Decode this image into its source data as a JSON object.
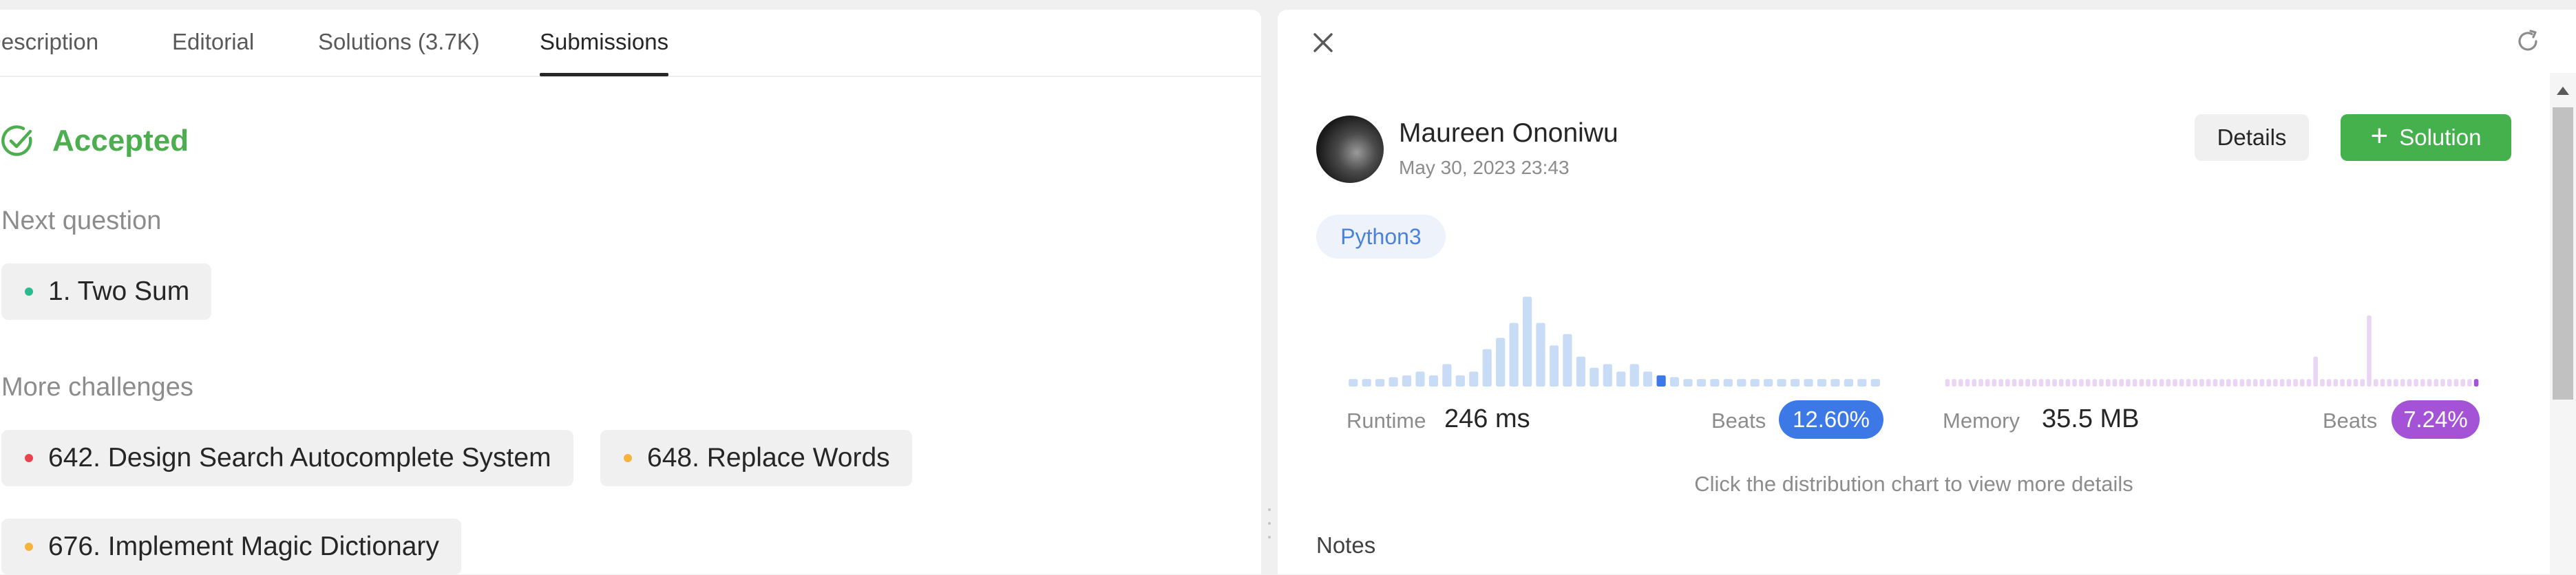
{
  "tabs": [
    {
      "label": "Description"
    },
    {
      "label": "Editorial"
    },
    {
      "label": "Solutions (3.7K)"
    },
    {
      "label": "Submissions"
    }
  ],
  "result": {
    "status": "Accepted",
    "status_color": "#4cae4f"
  },
  "next_question": {
    "heading": "Next question",
    "item": {
      "label": "1. Two Sum",
      "difficulty": "Easy",
      "dot_color": "#2cbb8e"
    }
  },
  "more_challenges": {
    "heading": "More challenges",
    "items": [
      {
        "label": "642. Design Search Autocomplete System",
        "difficulty": "Hard",
        "dot_color": "#e8434f"
      },
      {
        "label": "648. Replace Words",
        "difficulty": "Medium",
        "dot_color": "#f5b33b"
      },
      {
        "label": "676. Implement Magic Dictionary",
        "difficulty": "Medium",
        "dot_color": "#f5b33b"
      }
    ]
  },
  "submission": {
    "user": "Maureen Ononiwu",
    "date": "May 30, 2023 23:43",
    "details_label": "Details",
    "solution_label": "Solution",
    "language": "Python3"
  },
  "runtime": {
    "label": "Runtime",
    "value": "246 ms",
    "beats_label": "Beats",
    "beats": "12.60%",
    "beats_pct": 12.6,
    "badge_color": "#3c78e6",
    "bar_color": "#c8dcf6",
    "highlight_color": "#3c78e6"
  },
  "memory": {
    "label": "Memory",
    "value": "35.5 MB",
    "beats_label": "Beats",
    "beats": "7.24%",
    "beats_pct": 7.24,
    "badge_color": "#a452d6",
    "bar_color": "#ead5f4",
    "highlight_color": "#a452d6"
  },
  "chart_data": [
    {
      "type": "bar",
      "title": "",
      "series": [
        {
          "values": [
            0.04,
            0.04,
            0.04,
            0.05,
            0.06,
            0.08,
            0.06,
            0.12,
            0.06,
            0.08,
            0.2,
            0.26,
            0.34,
            0.48,
            0.34,
            0.22,
            0.28,
            0.16,
            0.1,
            0.12,
            0.08,
            0.12,
            0.08,
            0.06,
            0.05,
            0.04,
            0.04,
            0.04,
            0.04,
            0.04,
            0.04,
            0.04,
            0.04,
            0.04,
            0.04,
            0.04,
            0.04,
            0.04,
            0.04,
            0.04
          ]
        }
      ],
      "highlight_index": 23
    },
    {
      "type": "bar",
      "title": "",
      "series": [
        {
          "values": [
            0.04,
            0.04,
            0.04,
            0.04,
            0.04,
            0.04,
            0.04,
            0.04,
            0.04,
            0.04,
            0.04,
            0.04,
            0.04,
            0.04,
            0.04,
            0.04,
            0.04,
            0.04,
            0.04,
            0.04,
            0.04,
            0.04,
            0.04,
            0.04,
            0.04,
            0.04,
            0.04,
            0.04,
            0.04,
            0.04,
            0.04,
            0.04,
            0.04,
            0.04,
            0.04,
            0.04,
            0.04,
            0.04,
            0.04,
            0.04,
            0.04,
            0.04,
            0.04,
            0.04,
            0.04,
            0.04,
            0.04,
            0.04,
            0.04,
            0.04,
            0.04,
            0.04,
            0.04,
            0.04,
            0.04,
            0.16,
            0.04,
            0.04,
            0.04,
            0.04,
            0.04,
            0.04,
            0.04,
            0.38,
            0.04,
            0.04,
            0.04,
            0.04,
            0.04,
            0.04,
            0.04,
            0.04,
            0.04,
            0.04,
            0.04,
            0.04,
            0.04,
            0.04,
            0.04,
            0.04
          ]
        }
      ],
      "highlight_index": 79
    }
  ],
  "hint": "Click the distribution chart to view more details",
  "notes_label": "Notes"
}
